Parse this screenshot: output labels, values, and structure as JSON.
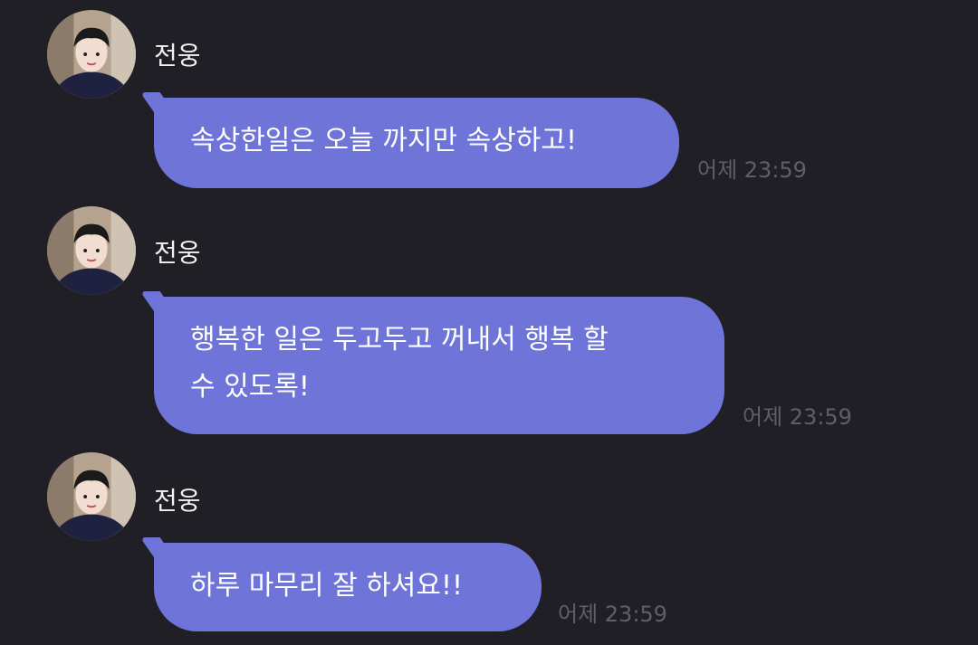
{
  "messages": [
    {
      "sender": "전웅",
      "text": "속상한일은 오늘 까지만 속상하고!",
      "time": "어제 23:59"
    },
    {
      "sender": "전웅",
      "text_lines": [
        "행복한 일은 두고두고 꺼내서 행복 할",
        "수 있도록!"
      ],
      "time": "어제 23:59"
    },
    {
      "sender": "전웅",
      "text": "하루 마무리 잘 하셔요!!",
      "time": "어제 23:59"
    }
  ],
  "colors": {
    "background": "#1f1f25",
    "bubble": "#6f74d8",
    "timestamp": "#5f5f66"
  }
}
